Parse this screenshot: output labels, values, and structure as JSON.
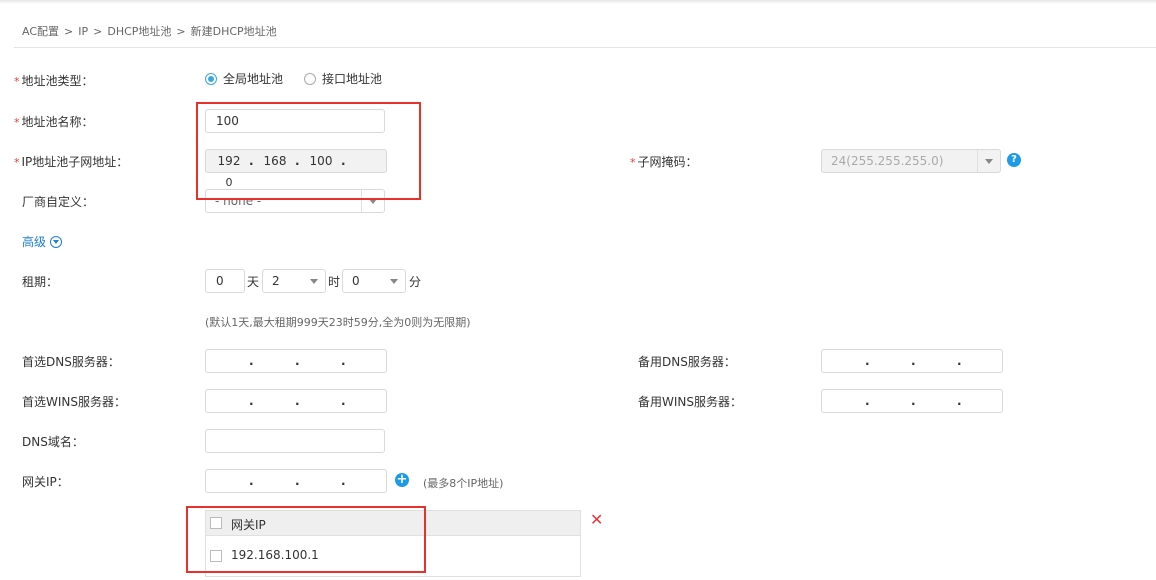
{
  "breadcrumb": [
    "AC配置",
    "IP",
    "DHCP地址池",
    "新建DHCP地址池"
  ],
  "form": {
    "pool_type": {
      "label": "地址池类型：",
      "options": [
        "全局地址池",
        "接口地址池"
      ],
      "selected": "全局地址池"
    },
    "pool_name": {
      "label": "地址池名称：",
      "value": "100"
    },
    "subnet": {
      "label": "IP地址池子网地址：",
      "octets": [
        "192",
        "168",
        "100",
        "0"
      ]
    },
    "mask": {
      "label": "子网掩码：",
      "value": "24(255.255.255.0)"
    },
    "vendor": {
      "label": "厂商自定义：",
      "value": "- none -"
    },
    "advanced": {
      "label": "高级"
    },
    "lease": {
      "label": "租期：",
      "days": "0",
      "days_unit": "天",
      "hours": "2",
      "hours_unit": "时",
      "minutes": "0",
      "minutes_unit": "分",
      "hint": "(默认1天,最大租期999天23时59分,全为0则为无限期)"
    },
    "dns_primary": {
      "label": "首选DNS服务器："
    },
    "dns_backup": {
      "label": "备用DNS服务器："
    },
    "wins_primary": {
      "label": "首选WINS服务器："
    },
    "wins_backup": {
      "label": "备用WINS服务器："
    },
    "dns_domain": {
      "label": "DNS域名：",
      "value": ""
    },
    "gateway": {
      "label": "网关IP：",
      "hint": "(最多8个IP地址)"
    }
  },
  "gateway_table": {
    "header": "网关IP",
    "rows": [
      "192.168.100.1"
    ]
  },
  "colors": {
    "accent": "#1e9be8",
    "required": "#e4393c",
    "highlight": "#e8302d"
  }
}
